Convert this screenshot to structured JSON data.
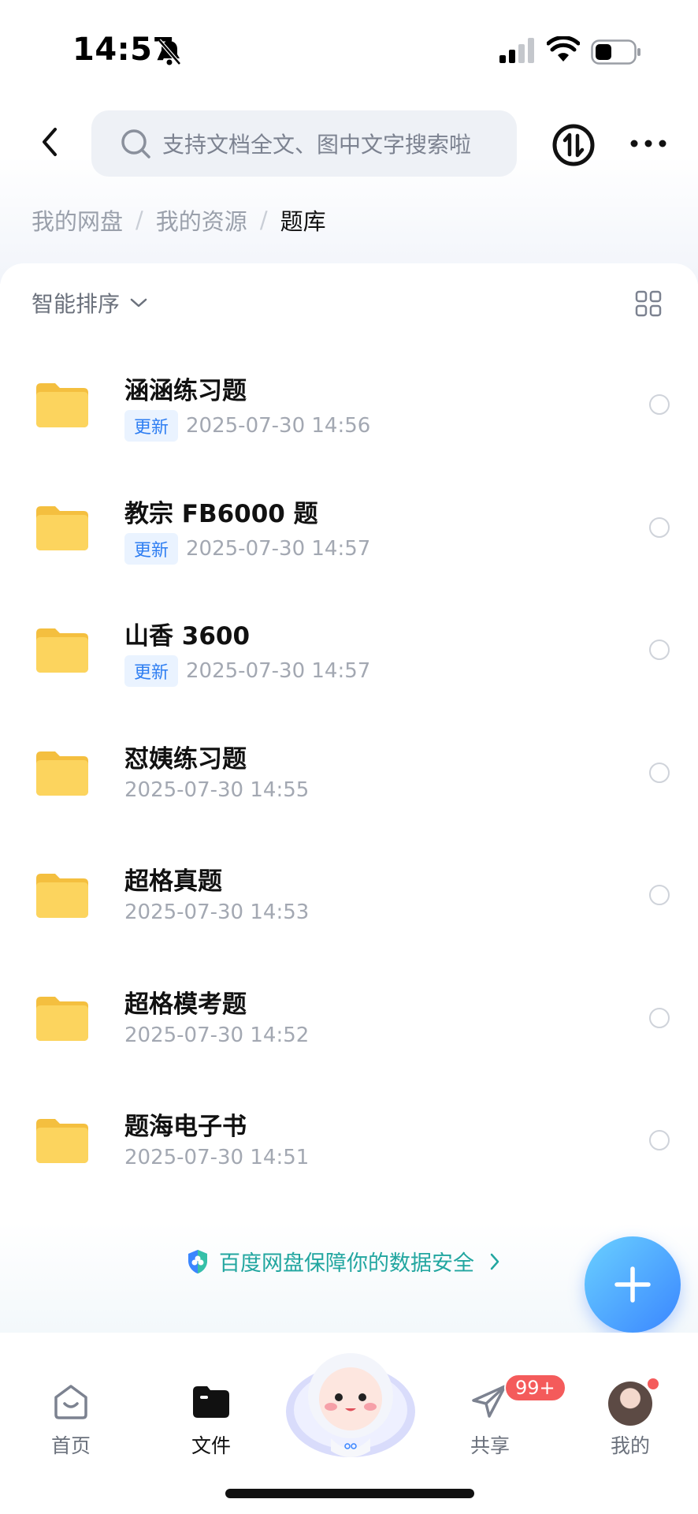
{
  "status_bar": {
    "time": "14:57"
  },
  "search": {
    "placeholder": "支持文档全文、图中文字搜索啦"
  },
  "breadcrumb": {
    "items": [
      "我的网盘",
      "我的资源"
    ],
    "current": "题库",
    "separator": "/"
  },
  "toolbar": {
    "sort_label": "智能排序"
  },
  "files": [
    {
      "name": "涵涵练习题",
      "badge": "更新",
      "time": "2025-07-30 14:56"
    },
    {
      "name": "教宗 FB6000 题",
      "badge": "更新",
      "time": "2025-07-30 14:57"
    },
    {
      "name": "山香 3600",
      "badge": "更新",
      "time": "2025-07-30 14:57"
    },
    {
      "name": "怼姨练习题",
      "badge": "",
      "time": "2025-07-30 14:55"
    },
    {
      "name": "超格真题",
      "badge": "",
      "time": "2025-07-30 14:53"
    },
    {
      "name": "超格模考题",
      "badge": "",
      "time": "2025-07-30 14:52"
    },
    {
      "name": "题海电子书",
      "badge": "",
      "time": "2025-07-30 14:51"
    }
  ],
  "security": {
    "text": "百度网盘保障你的数据安全"
  },
  "tabs": [
    {
      "label": "首页"
    },
    {
      "label": "文件"
    },
    {
      "label": "共享"
    },
    {
      "label": "我的"
    }
  ],
  "share_badge": "99+",
  "colors": {
    "accent": "#3a86ff",
    "badge_text": "#2e7ef2",
    "security_text": "#22a6a0",
    "folder": "#fbcf55"
  }
}
